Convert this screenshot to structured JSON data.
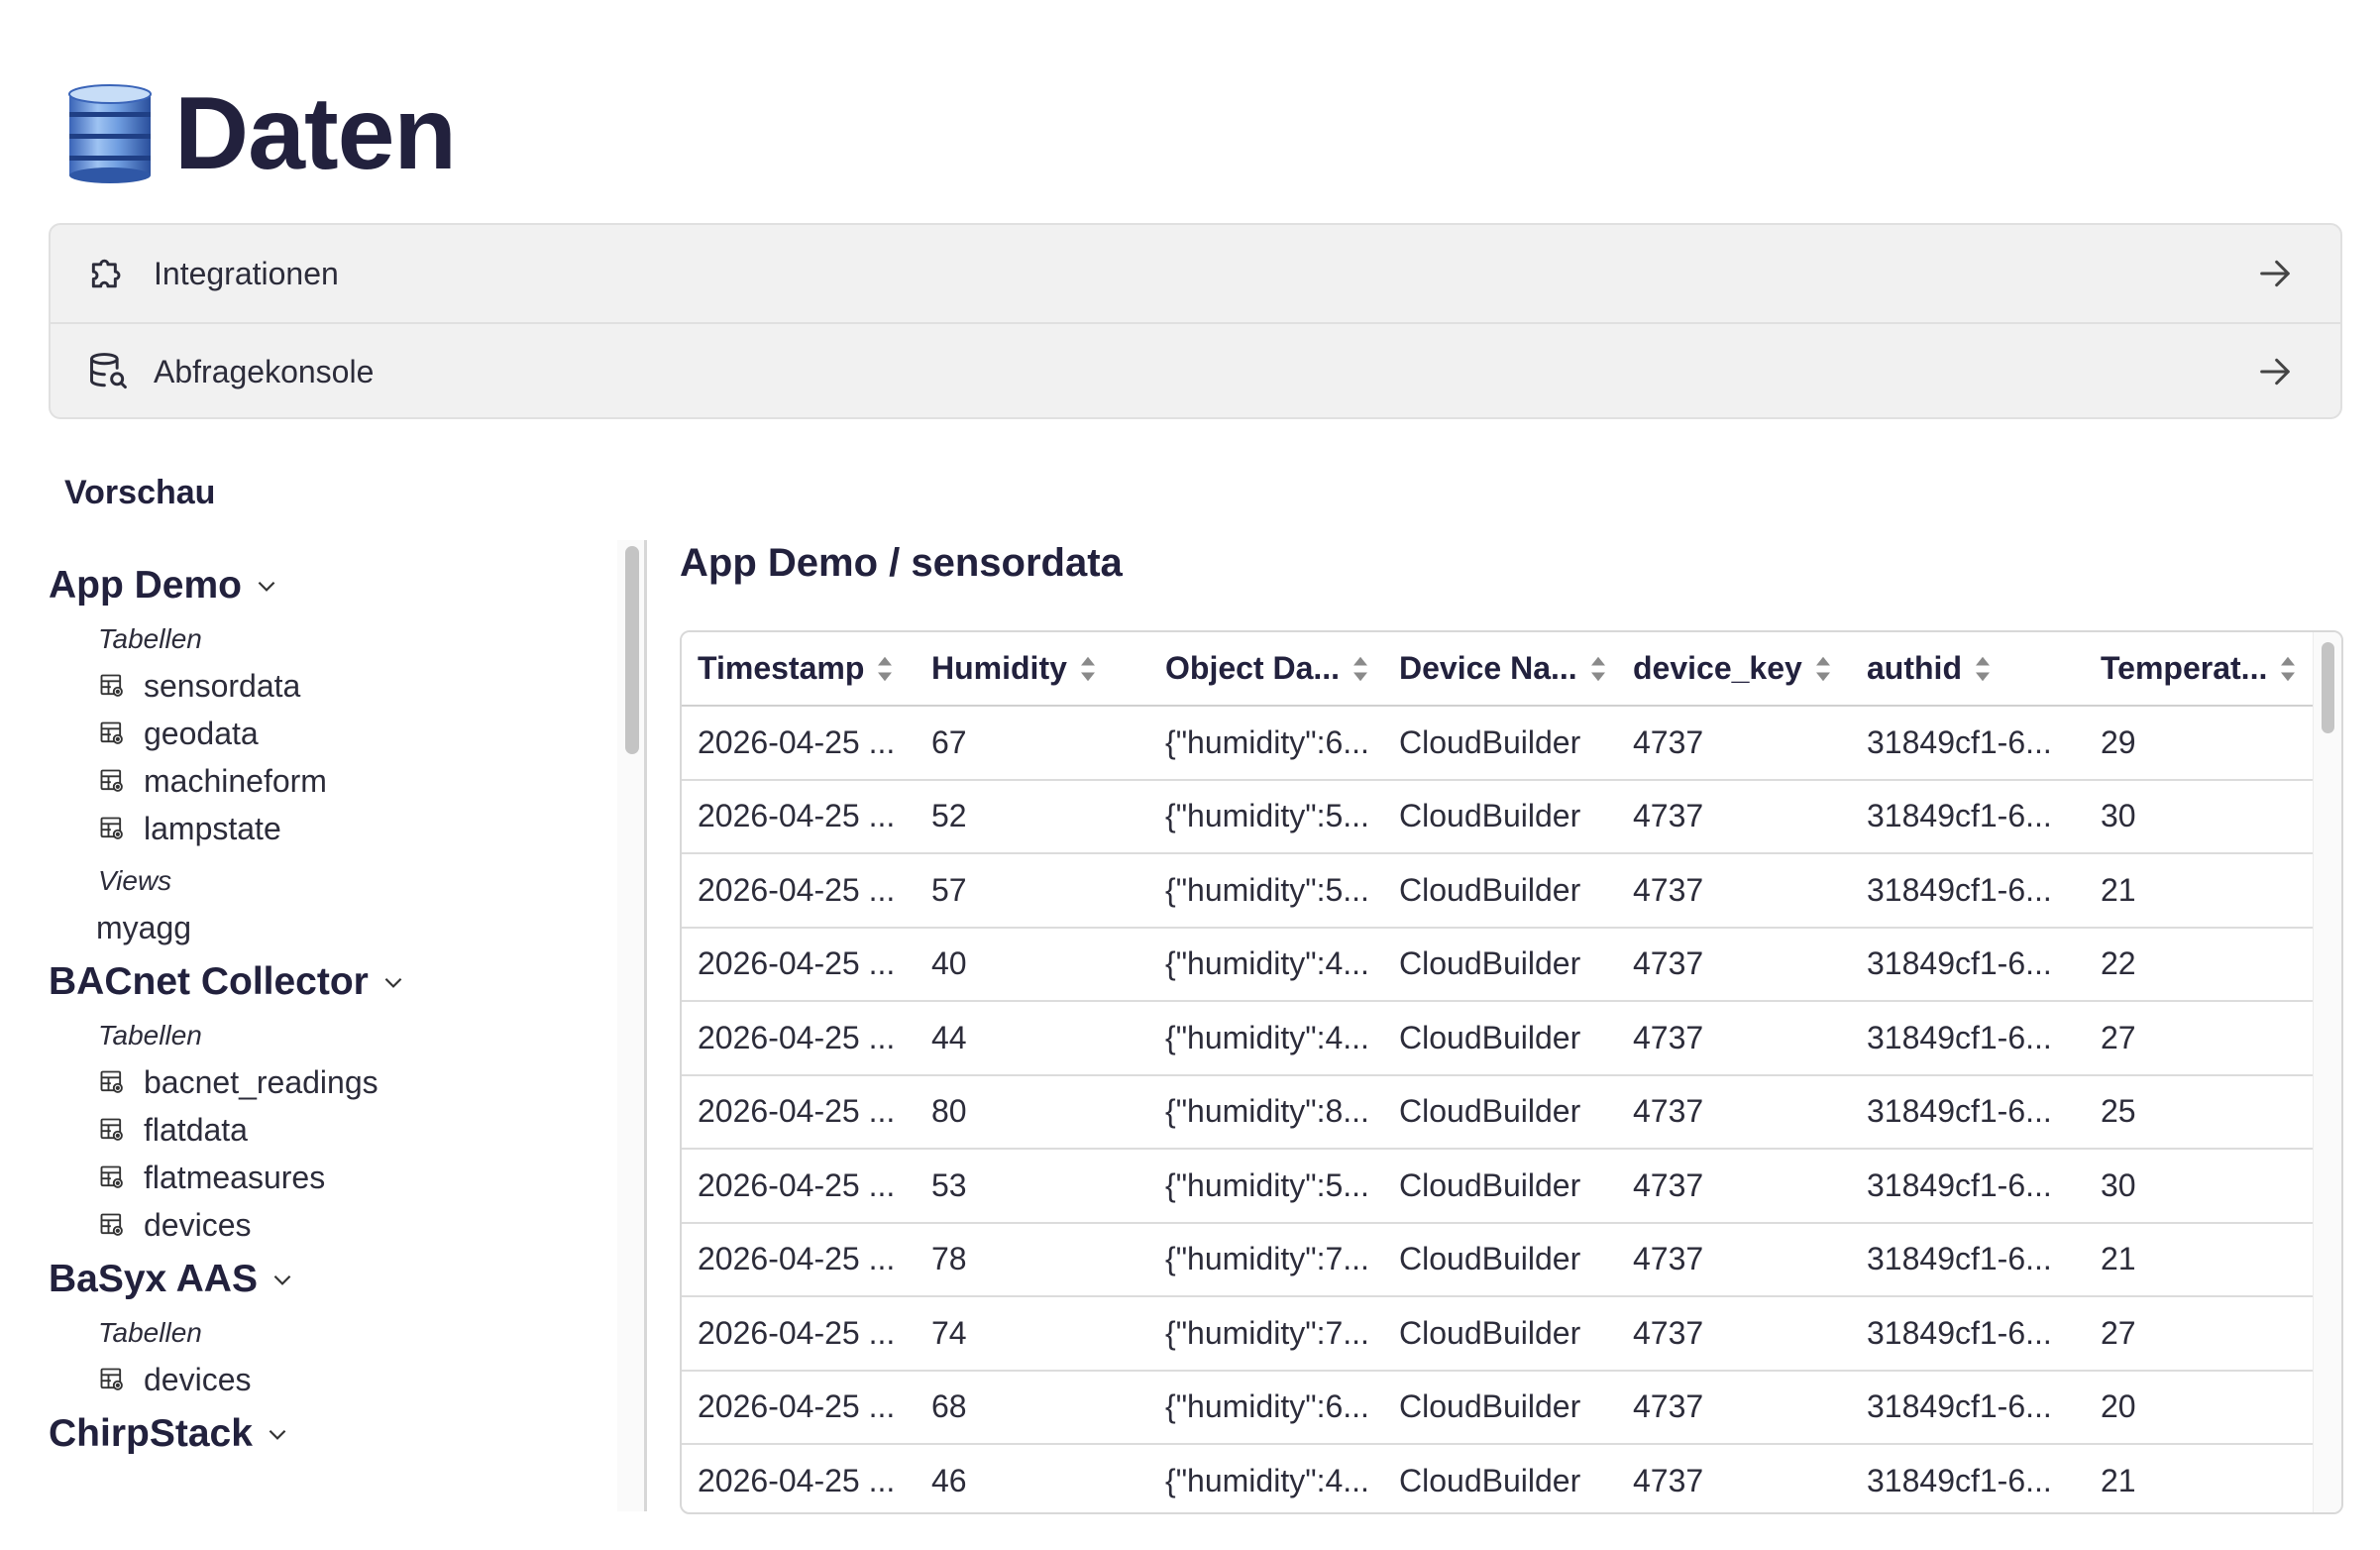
{
  "header": {
    "title": "Daten",
    "icon": "database-icon"
  },
  "nav": [
    {
      "label": "Integrationen",
      "icon": "puzzle-icon"
    },
    {
      "label": "Abfragekonsole",
      "icon": "database-search-icon"
    }
  ],
  "preview": {
    "title": "Vorschau",
    "groups": [
      {
        "name": "App Demo",
        "tables_label": "Tabellen",
        "tables": [
          "sensordata",
          "geodata",
          "machineform",
          "lampstate"
        ],
        "views_label": "Views",
        "views": [
          "myagg"
        ]
      },
      {
        "name": "BACnet Collector",
        "tables_label": "Tabellen",
        "tables": [
          "bacnet_readings",
          "flatdata",
          "flatmeasures",
          "devices"
        ]
      },
      {
        "name": "BaSyx AAS",
        "tables_label": "Tabellen",
        "tables": [
          "devices"
        ]
      },
      {
        "name": "ChirpStack"
      }
    ]
  },
  "panel": {
    "title": "App Demo / sensordata",
    "columns": [
      "Timestamp",
      "Humidity",
      "Object Da...",
      "Device Na...",
      "device_key",
      "authid",
      "Temperat..."
    ],
    "rows": [
      [
        "2026-04-25 ...",
        "67",
        "{\"humidity\":6...",
        "CloudBuilder",
        "4737",
        "31849cf1-6...",
        "29"
      ],
      [
        "2026-04-25 ...",
        "52",
        "{\"humidity\":5...",
        "CloudBuilder",
        "4737",
        "31849cf1-6...",
        "30"
      ],
      [
        "2026-04-25 ...",
        "57",
        "{\"humidity\":5...",
        "CloudBuilder",
        "4737",
        "31849cf1-6...",
        "21"
      ],
      [
        "2026-04-25 ...",
        "40",
        "{\"humidity\":4...",
        "CloudBuilder",
        "4737",
        "31849cf1-6...",
        "22"
      ],
      [
        "2026-04-25 ...",
        "44",
        "{\"humidity\":4...",
        "CloudBuilder",
        "4737",
        "31849cf1-6...",
        "27"
      ],
      [
        "2026-04-25 ...",
        "80",
        "{\"humidity\":8...",
        "CloudBuilder",
        "4737",
        "31849cf1-6...",
        "25"
      ],
      [
        "2026-04-25 ...",
        "53",
        "{\"humidity\":5...",
        "CloudBuilder",
        "4737",
        "31849cf1-6...",
        "30"
      ],
      [
        "2026-04-25 ...",
        "78",
        "{\"humidity\":7...",
        "CloudBuilder",
        "4737",
        "31849cf1-6...",
        "21"
      ],
      [
        "2026-04-25 ...",
        "74",
        "{\"humidity\":7...",
        "CloudBuilder",
        "4737",
        "31849cf1-6...",
        "27"
      ],
      [
        "2026-04-25 ...",
        "68",
        "{\"humidity\":6...",
        "CloudBuilder",
        "4737",
        "31849cf1-6...",
        "20"
      ],
      [
        "2026-04-25 ...",
        "46",
        "{\"humidity\":4...",
        "CloudBuilder",
        "4737",
        "31849cf1-6...",
        "21"
      ]
    ]
  },
  "colors": {
    "text_dark": "#22213d",
    "card_bg": "#f1f1f1",
    "border": "#e0e0e0"
  }
}
